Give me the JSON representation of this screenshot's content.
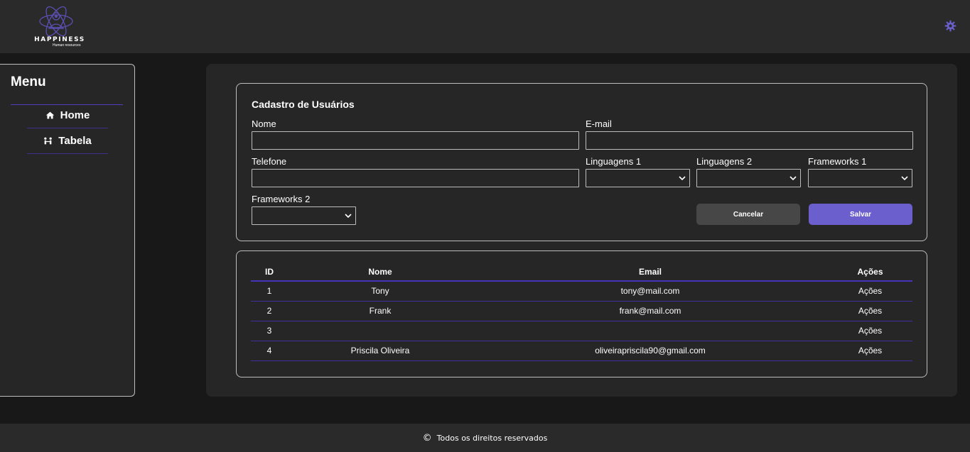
{
  "header": {
    "logo_title": "HAPPINESS",
    "logo_subtitle": "Human resources",
    "settings_icon": "gear-icon",
    "accent_color": "#6a5fcc"
  },
  "sidebar": {
    "title": "Menu",
    "items": [
      {
        "label": "Home",
        "icon": "home-icon"
      },
      {
        "label": "Tabela",
        "icon": "people-icon"
      }
    ]
  },
  "form": {
    "title": "Cadastro de Usuários",
    "fields": {
      "nome": {
        "label": "Nome",
        "value": ""
      },
      "email": {
        "label": "E-mail",
        "value": ""
      },
      "telefone": {
        "label": "Telefone",
        "value": ""
      },
      "linguagens1": {
        "label": "Linguagens 1",
        "value": ""
      },
      "linguagens2": {
        "label": "Linguagens 2",
        "value": ""
      },
      "frameworks1": {
        "label": "Frameworks 1",
        "value": ""
      },
      "frameworks2": {
        "label": "Frameworks 2",
        "value": ""
      }
    },
    "cancel_label": "Cancelar",
    "save_label": "Salvar"
  },
  "table": {
    "columns": [
      "ID",
      "Nome",
      "Email",
      "Ações"
    ],
    "rows": [
      {
        "id": "1",
        "nome": "Tony",
        "email": "tony@mail.com",
        "acoes": "Ações"
      },
      {
        "id": "2",
        "nome": "Frank",
        "email": "frank@mail.com",
        "acoes": "Ações"
      },
      {
        "id": "3",
        "nome": "",
        "email": "",
        "acoes": "Ações"
      },
      {
        "id": "4",
        "nome": "Priscila Oliveira",
        "email": "oliveirapriscila90@gmail.com",
        "acoes": "Ações"
      }
    ]
  },
  "footer": {
    "text": "Todos os direitos reservados",
    "icon": "copyright-icon"
  }
}
